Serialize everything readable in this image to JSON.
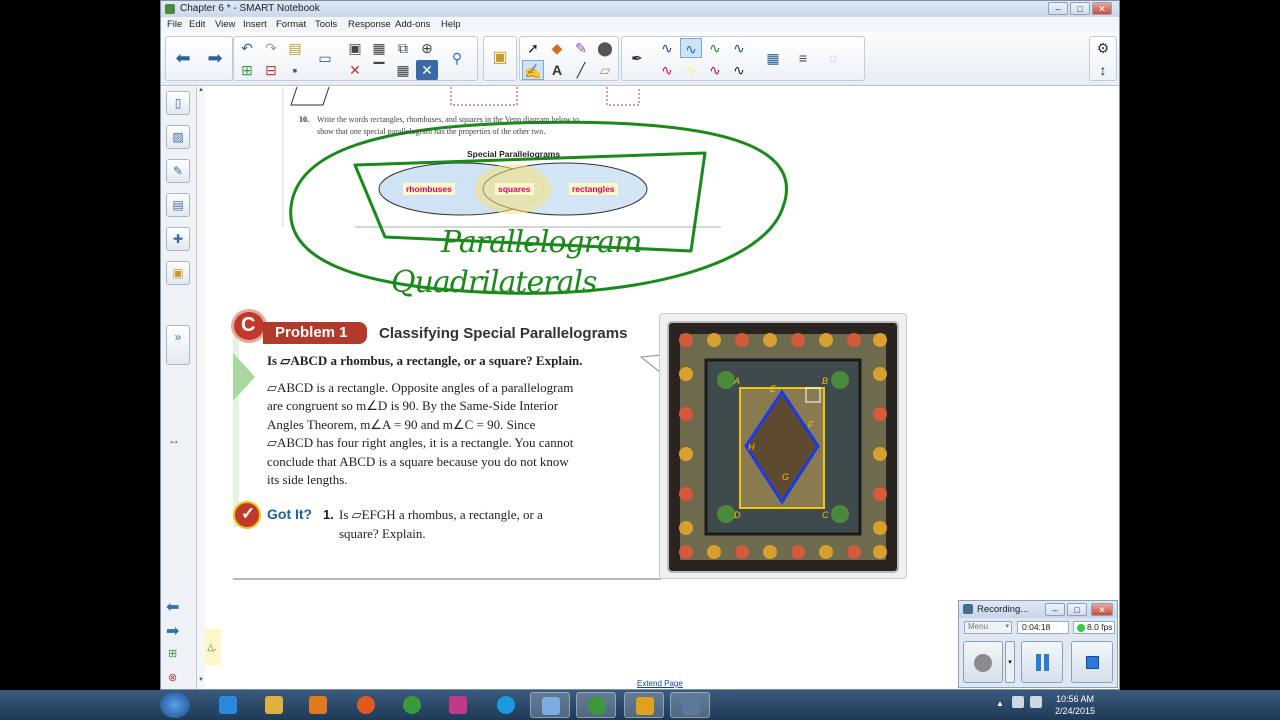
{
  "window": {
    "title": "Chapter 6 * - SMART Notebook",
    "menu": [
      "File",
      "Edit",
      "View",
      "Insert",
      "Format",
      "Tools",
      "Response",
      "Add-ons",
      "Help"
    ]
  },
  "page": {
    "q10_number": "10.",
    "q10_line1": "Write the words rectangles, rhombuses, and squares in the Venn diagram below to",
    "q10_line2": "show that one special parallelogram has the properties of the other two.",
    "venn_title": "Special Parallelograms",
    "venn_left": "rhombuses",
    "venn_center": "squares",
    "venn_right": "rectangles",
    "handwriting_1": "Parallelogram",
    "handwriting_2": "Quadrilaterals",
    "problem_label": "Problem 1",
    "problem_title": "Classifying Special Parallelograms",
    "question": "Is ▱ABCD a rhombus, a rectangle, or a square? Explain.",
    "answer_lines": [
      "▱ABCD is a rectangle. Opposite angles of a parallelogram",
      "are congruent so m∠D is 90. By the Same-Side Interior",
      "Angles Theorem, m∠A = 90 and m∠C = 90. Since",
      "▱ABCD has four right angles, it is a rectangle. You cannot",
      "conclude that ABCD is a square because you do not know",
      "its side lengths."
    ],
    "got_it_label": "Got It?",
    "got_it_num": "1.",
    "got_it_line1": "Is ▱EFGH a rhombus, a rectangle, or a",
    "got_it_line2": "square? Explain.",
    "figure_labels": {
      "A": "A",
      "B": "B",
      "C": "C",
      "D": "D",
      "E": "E",
      "F": "F",
      "G": "G",
      "H": "H"
    },
    "extend_page": "Extend Page"
  },
  "recorder": {
    "title": "Recording...",
    "menu_label": "Menu",
    "elapsed": "0:04:18",
    "fps": "8.0 fps"
  },
  "taskbar": {
    "time": "10:56 AM",
    "date": "2/24/2015"
  },
  "colors": {
    "accent_green": "#1a8a1a",
    "problem_red": "#c0392b",
    "venn_fill": "#cfe3f4",
    "label_pink": "#d6006c"
  }
}
